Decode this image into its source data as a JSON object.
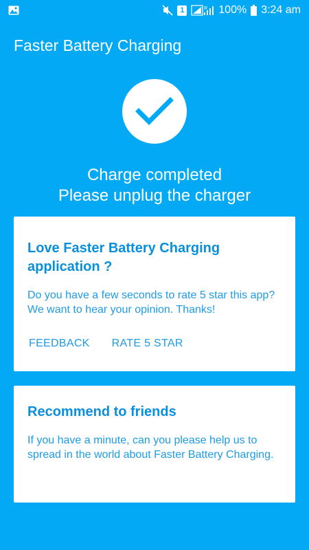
{
  "status_bar": {
    "sim_slot": "1",
    "battery": "100%",
    "time": "3:24 am",
    "icons": [
      "image-icon",
      "mute-icon",
      "sim-icon",
      "signal-icon",
      "battery-icon"
    ]
  },
  "header": {
    "title": "Faster Battery Charging"
  },
  "status": {
    "icon": "checkmark-icon",
    "line1": "Charge completed",
    "line2": "Please unplug the charger"
  },
  "rate_card": {
    "title": "Love Faster Battery Charging application ?",
    "body": "Do you have a few seconds to rate 5 star this app? We want to hear your opinion. Thanks!",
    "feedback_label": "FEEDBACK",
    "rate_label": "RATE 5 STAR"
  },
  "recommend_card": {
    "title": "Recommend to friends",
    "body": "If you have a minute, can you please help us to spread in the world about Faster Battery Charging."
  },
  "colors": {
    "background": "#03A9F4",
    "card": "#FFFFFF",
    "card_title": "#0A8FDC",
    "card_text": "#1E9BE5"
  }
}
